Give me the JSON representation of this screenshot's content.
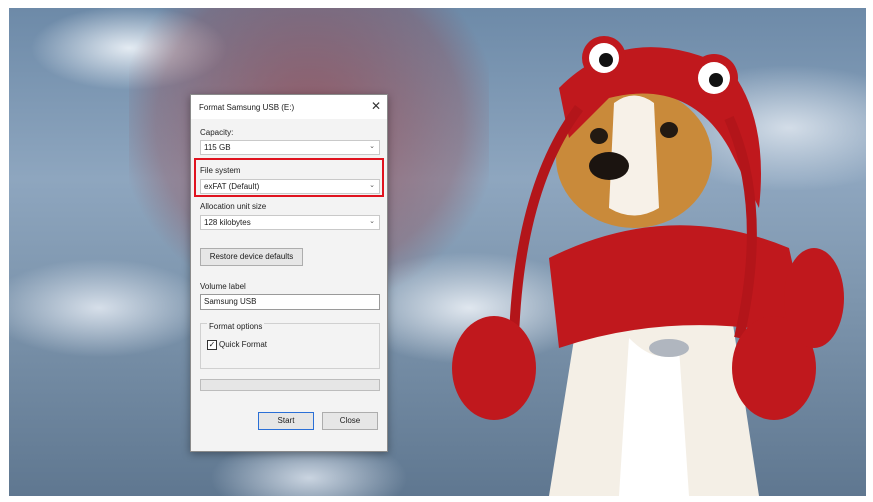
{
  "dialog": {
    "title": "Format Samsung USB (E:)",
    "capacity": {
      "label": "Capacity:",
      "value": "115 GB"
    },
    "file_system": {
      "label": "File system",
      "value": "exFAT (Default)"
    },
    "allocation": {
      "label": "Allocation unit size",
      "value": "128 kilobytes"
    },
    "restore_button": "Restore device defaults",
    "volume_label": {
      "label": "Volume label",
      "value": "Samsung USB"
    },
    "format_options": {
      "label": "Format options",
      "quick_format_label": "Quick Format",
      "quick_format_checked": true
    },
    "progress": 0,
    "start_button": "Start",
    "close_button": "Close"
  },
  "colors": {
    "highlight": "#e0131f",
    "costume_red": "#c0181d"
  },
  "icons": {
    "close": "close-icon",
    "dropdown": "chevron-down-icon",
    "check": "checkmark-icon"
  }
}
